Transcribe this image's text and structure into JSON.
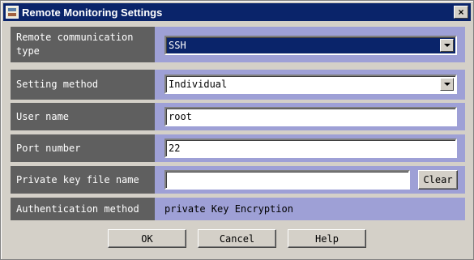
{
  "window": {
    "title": "Remote Monitoring Settings",
    "close_glyph": "×"
  },
  "form": {
    "remote_type": {
      "label": "Remote communication type",
      "value": "SSH"
    },
    "setting_method": {
      "label": "Setting method",
      "value": "Individual"
    },
    "user_name": {
      "label": "User name",
      "value": "root"
    },
    "port_number": {
      "label": "Port number",
      "value": "22"
    },
    "private_key": {
      "label": "Private key file name",
      "value": "",
      "clear_label": "Clear"
    },
    "auth_method": {
      "label": "Authentication method",
      "value": "private Key Encryption"
    }
  },
  "buttons": {
    "ok": "OK",
    "cancel": "Cancel",
    "help": "Help"
  }
}
